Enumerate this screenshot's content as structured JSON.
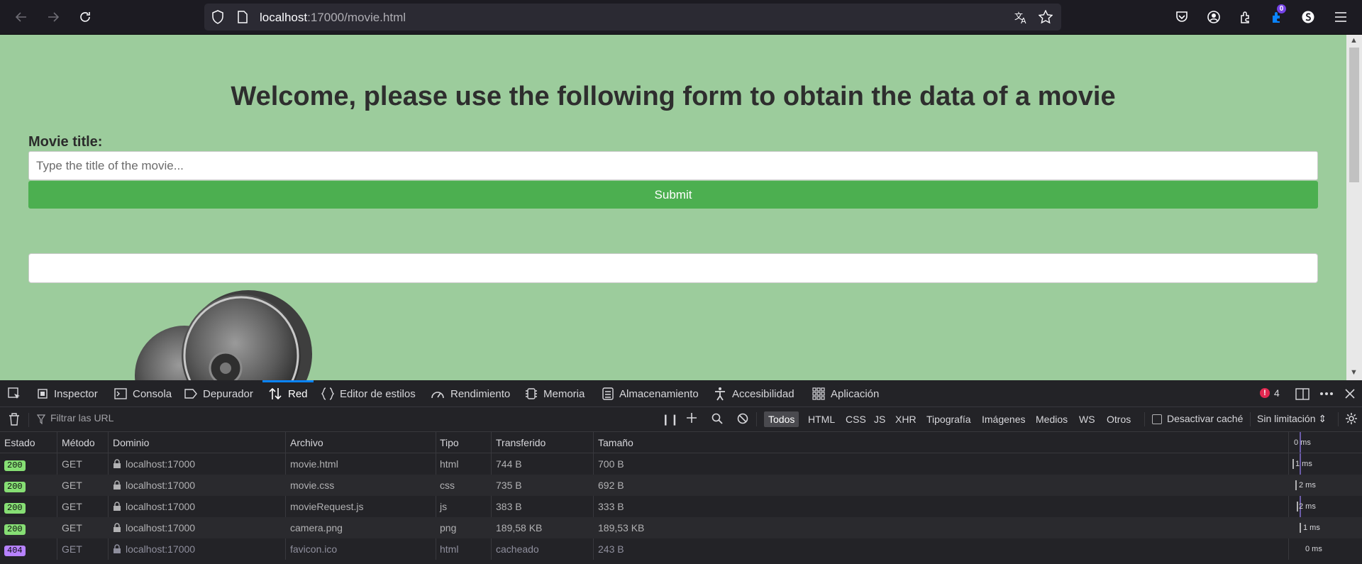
{
  "browser": {
    "url_host": "localhost",
    "url_rest": ":17000/movie.html",
    "extension_badge": "0"
  },
  "page": {
    "heading": "Welcome, please use the following form to obtain the data of a movie",
    "field_label": "Movie title:",
    "input_placeholder": "Type the title of the movie...",
    "input_value": "",
    "submit_label": "Submit",
    "result_text": ""
  },
  "devtools": {
    "tabs": [
      {
        "label": "Inspector",
        "icon": "inspector-icon"
      },
      {
        "label": "Consola",
        "icon": "console-icon"
      },
      {
        "label": "Depurador",
        "icon": "debugger-icon"
      },
      {
        "label": "Red",
        "icon": "network-icon",
        "active": true
      },
      {
        "label": "Editor de estilos",
        "icon": "style-editor-icon"
      },
      {
        "label": "Rendimiento",
        "icon": "performance-icon"
      },
      {
        "label": "Memoria",
        "icon": "memory-icon"
      },
      {
        "label": "Almacenamiento",
        "icon": "storage-icon"
      },
      {
        "label": "Accesibilidad",
        "icon": "accessibility-icon"
      },
      {
        "label": "Aplicación",
        "icon": "application-icon"
      }
    ],
    "error_count": "4",
    "filter_placeholder": "Filtrar las URL",
    "filters": [
      "Todos",
      "HTML",
      "CSS",
      "JS",
      "XHR",
      "Tipografía",
      "Imágenes",
      "Medios",
      "WS",
      "Otros"
    ],
    "active_filter": "Todos",
    "disable_cache_label": "Desactivar caché",
    "throttle_label": "Sin limitación",
    "columns": [
      "Estado",
      "Método",
      "Dominio",
      "Archivo",
      "Tipo",
      "Transferido",
      "Tamaño"
    ],
    "timeline_header": "0 ms",
    "requests": [
      {
        "status": "200",
        "method": "GET",
        "domain": "localhost:17000",
        "file": "movie.html",
        "type": "html",
        "transferred": "744 B",
        "size": "700 B",
        "timing": "1 ms"
      },
      {
        "status": "200",
        "method": "GET",
        "domain": "localhost:17000",
        "file": "movie.css",
        "type": "css",
        "transferred": "735 B",
        "size": "692 B",
        "timing": "2 ms"
      },
      {
        "status": "200",
        "method": "GET",
        "domain": "localhost:17000",
        "file": "movieRequest.js",
        "type": "js",
        "transferred": "383 B",
        "size": "333 B",
        "timing": "2 ms"
      },
      {
        "status": "200",
        "method": "GET",
        "domain": "localhost:17000",
        "file": "camera.png",
        "type": "png",
        "transferred": "189,58 KB",
        "size": "189,53 KB",
        "timing": "1 ms"
      },
      {
        "status": "404",
        "method": "GET",
        "domain": "localhost:17000",
        "file": "favicon.ico",
        "type": "html",
        "transferred": "cacheado",
        "size": "243 B",
        "timing": "0 ms"
      }
    ]
  }
}
